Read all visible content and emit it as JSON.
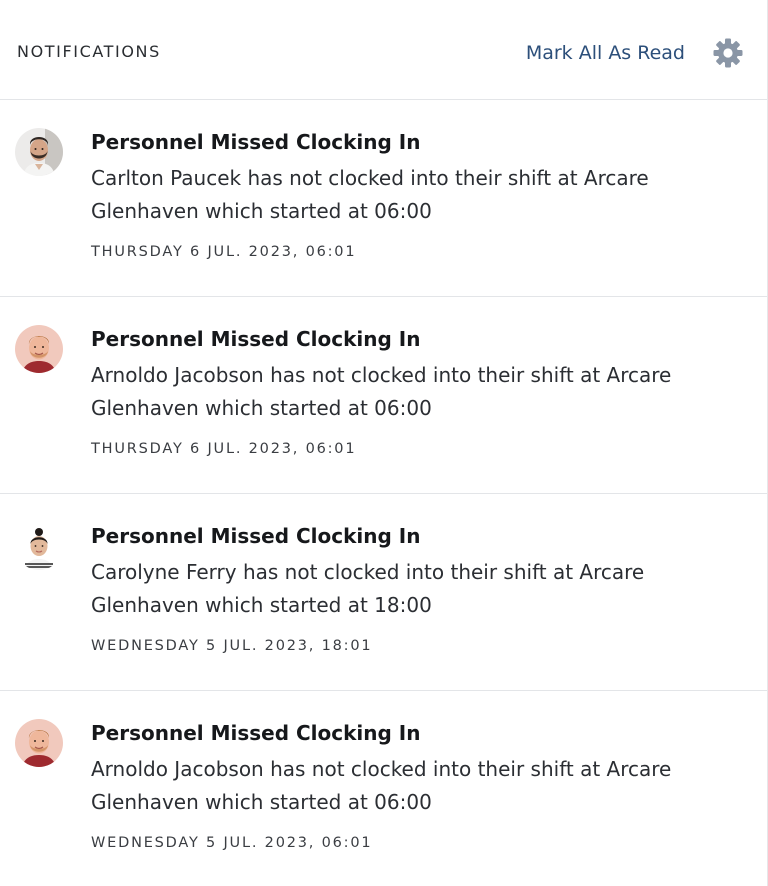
{
  "header": {
    "title": "NOTIFICATIONS",
    "mark_all_label": "Mark All As Read",
    "settings_icon": "gear-icon"
  },
  "colors": {
    "link": "#2c4f7a",
    "gear": "#8a96a6",
    "divider": "#e3e5e8"
  },
  "notifications": [
    {
      "avatar_icon": "avatar-man-beard",
      "title": "Personnel Missed Clocking In",
      "body": "Carlton Paucek has not clocked into their shift at Arcare Glenhaven which started at 06:00",
      "timestamp": "THURSDAY 6 JUL. 2023, 06:01"
    },
    {
      "avatar_icon": "avatar-man-redhead",
      "title": "Personnel Missed Clocking In",
      "body": "Arnoldo Jacobson has not clocked into their shift at Arcare Glenhaven which started at 06:00",
      "timestamp": "THURSDAY 6 JUL. 2023, 06:01"
    },
    {
      "avatar_icon": "avatar-woman",
      "title": "Personnel Missed Clocking In",
      "body": "Carolyne Ferry has not clocked into their shift at Arcare Glenhaven which started at 18:00",
      "timestamp": "WEDNESDAY 5 JUL. 2023, 18:01"
    },
    {
      "avatar_icon": "avatar-man-redhead",
      "title": "Personnel Missed Clocking In",
      "body": "Arnoldo Jacobson has not clocked into their shift at Arcare Glenhaven which started at 06:00",
      "timestamp": "WEDNESDAY 5 JUL. 2023, 06:01"
    }
  ]
}
